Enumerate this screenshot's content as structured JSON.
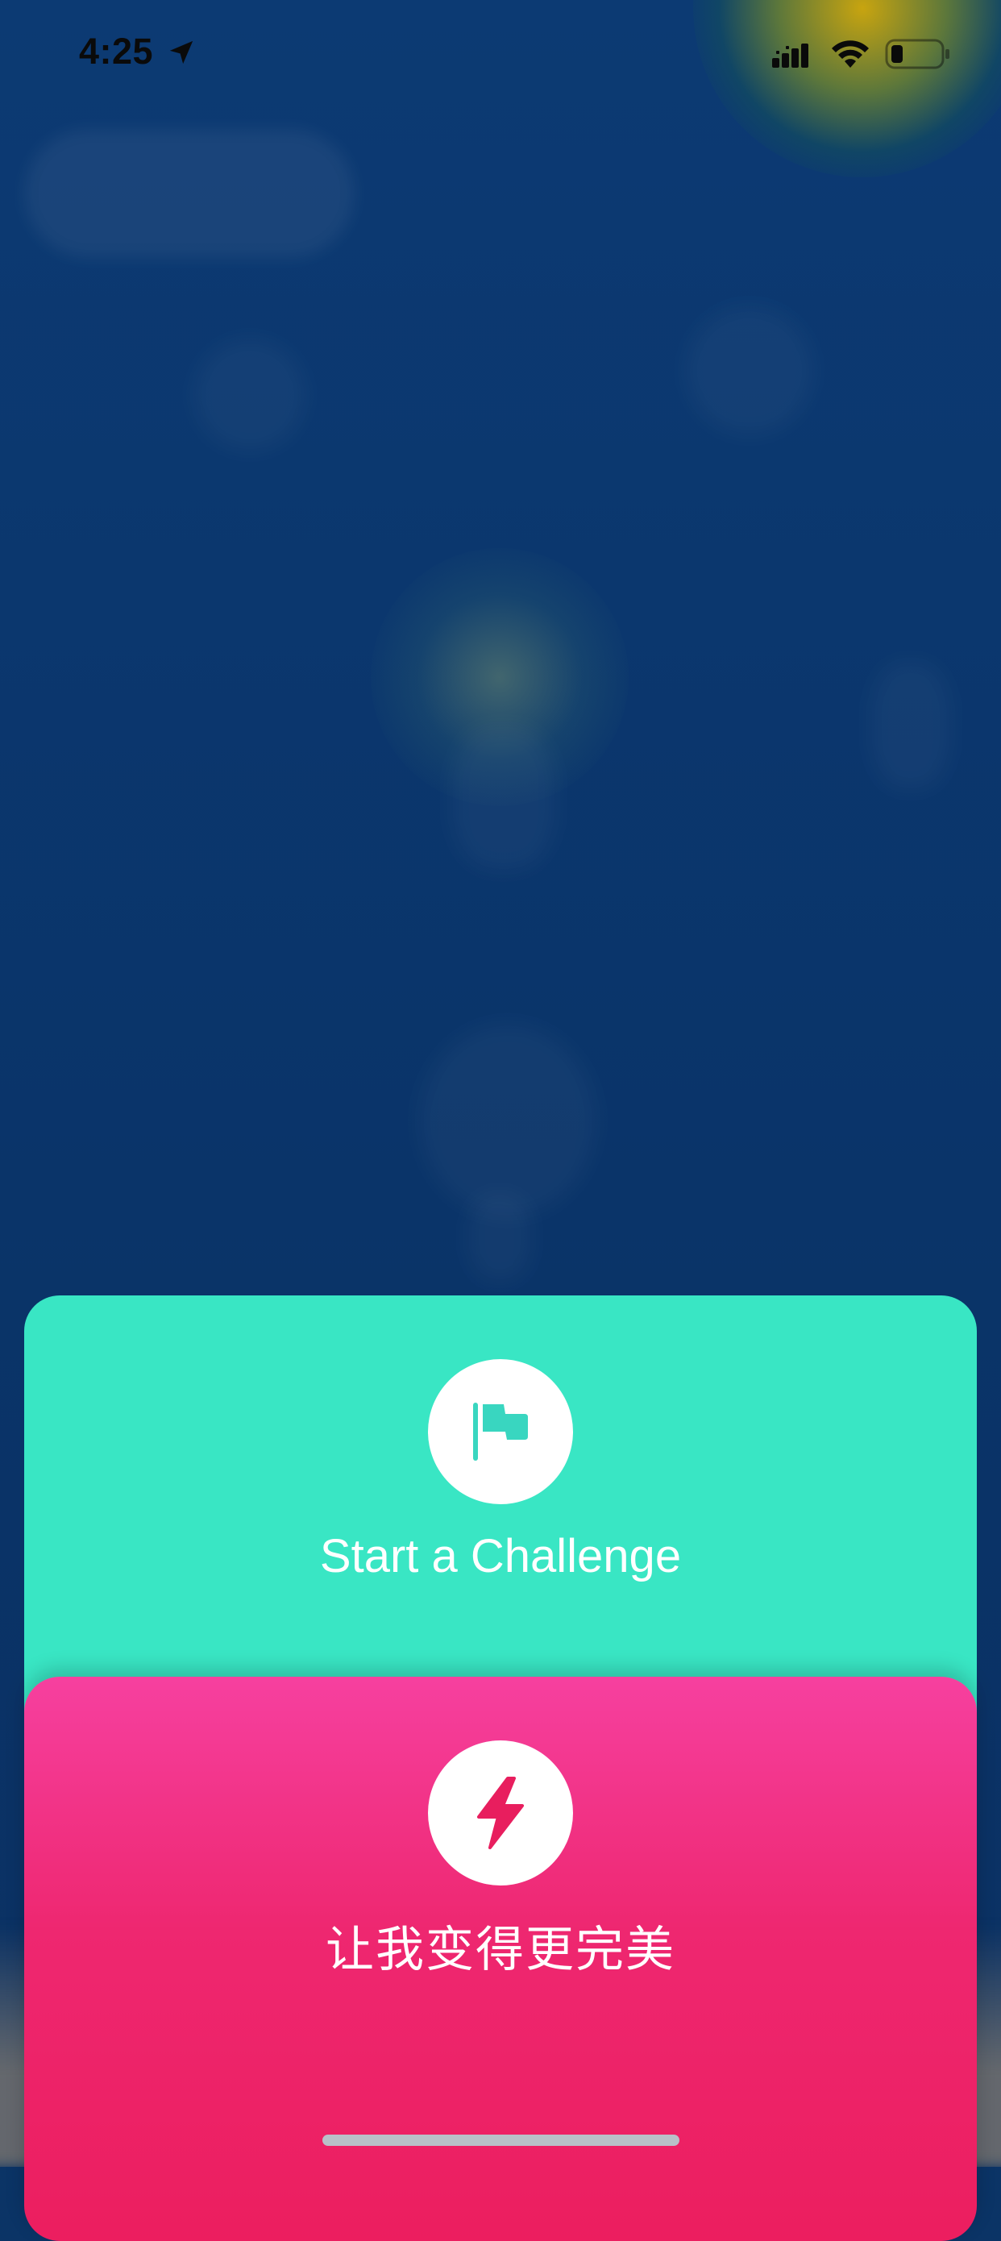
{
  "status_bar": {
    "time": "4:25",
    "location_icon": "location-arrow-icon",
    "cellular_icon": "cellular-signal-icon",
    "wifi_icon": "wifi-icon",
    "battery_icon": "battery-low-icon"
  },
  "actions": {
    "challenge": {
      "label": "Start a Challenge",
      "icon": "flag-icon",
      "color": "#39e6c4"
    },
    "improve": {
      "label": "让我变得更完美",
      "icon": "lightning-bolt-icon",
      "color": "#ee2770"
    }
  },
  "colors": {
    "background": "#0c3a73",
    "accent_teal": "#39e6c4",
    "accent_pink": "#ec1e5f",
    "icon_flag": "#39d6c0",
    "icon_bolt": "#e81e5e"
  }
}
